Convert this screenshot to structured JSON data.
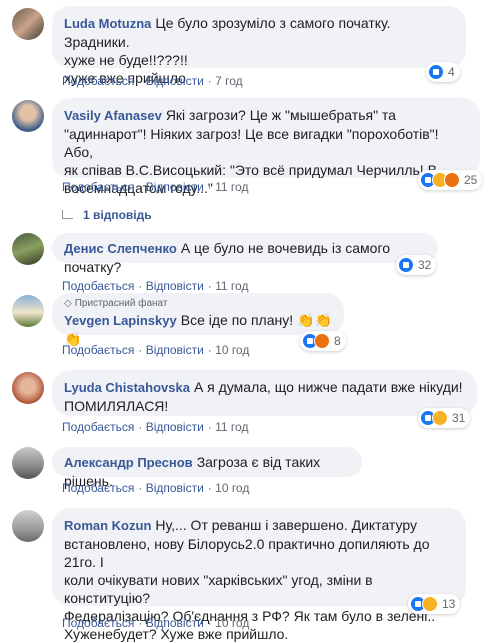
{
  "comments": [
    {
      "author": "Luda Motuzna",
      "text_lines": [
        "Це було зрозуміло з самого початку. Зрадники.",
        "хуже не буде!!???!!",
        "хуже вже прийшло"
      ],
      "like_label": "Подобається",
      "reply_label": "Відповісти",
      "time": "7 год",
      "reaction_count": "4",
      "reactions": [
        "like"
      ]
    },
    {
      "author": "Vasily Afanasev",
      "text_lines": [
        "Які загрози? Це ж \"мышебратья\" та",
        "\"адиннарот\"! Ніяких загроз! Це все вигадки \"порохоботів\"! Або,",
        "як співав В.С.Висоцький: \"Это всё придумал Черчилль! В",
        "восемнадцатом году...\""
      ],
      "like_label": "Подобається",
      "reply_label": "Відповісти",
      "time": "11 год",
      "reaction_count": "25",
      "reactions": [
        "like",
        "haha",
        "angry"
      ],
      "replies_label": "1 відповідь"
    },
    {
      "author": "Денис Слепченко",
      "text_lines": [
        "А це було не вочевидь із самого початку?"
      ],
      "like_label": "Подобається",
      "reply_label": "Відповісти",
      "time": "11 год",
      "reaction_count": "32",
      "reactions": [
        "like"
      ]
    },
    {
      "badge": "Пристрасний фанат",
      "author": "Yevgen Lapinskyy",
      "text_lines": [
        "Все іде по плану! 👏👏👏"
      ],
      "like_label": "Подобається",
      "reply_label": "Відповісти",
      "time": "10 год",
      "reaction_count": "8",
      "reactions": [
        "like",
        "angry"
      ]
    },
    {
      "author": "Lyuda Chistahovska",
      "text_lines": [
        "А я думала, що нижче падати вже нікуди!",
        "ПОМИЛЯЛАСЯ!"
      ],
      "like_label": "Подобається",
      "reply_label": "Відповісти",
      "time": "11 год",
      "reaction_count": "31",
      "reactions": [
        "like",
        "sad"
      ]
    },
    {
      "author": "Александр Преснов",
      "text_lines": [
        "Загроза є від таких рішень."
      ],
      "like_label": "Подобається",
      "reply_label": "Відповісти",
      "time": "10 год"
    },
    {
      "author": "Roman Kozun",
      "text_lines": [
        "Ну,... От реванш і завершено. Диктатуру",
        "встановлено, нову Білорусь2.0 практично допиляють до 21го. І",
        "коли очікувати нових \"харківських\" угод, зміни в конституцію?",
        "Федералізацію? Об'єднання з РФ? Як там було в зелені..",
        "Хуженебудет? Хуже вже прийшло."
      ],
      "like_label": "Подобається",
      "reply_label": "Відповісти",
      "time": "10 год",
      "reaction_count": "13",
      "reactions": [
        "like",
        "sad"
      ]
    }
  ],
  "colors": {
    "author": "#385898",
    "bubble": "#f0f2f5",
    "meta": "#606770",
    "like": "#1877f2"
  }
}
